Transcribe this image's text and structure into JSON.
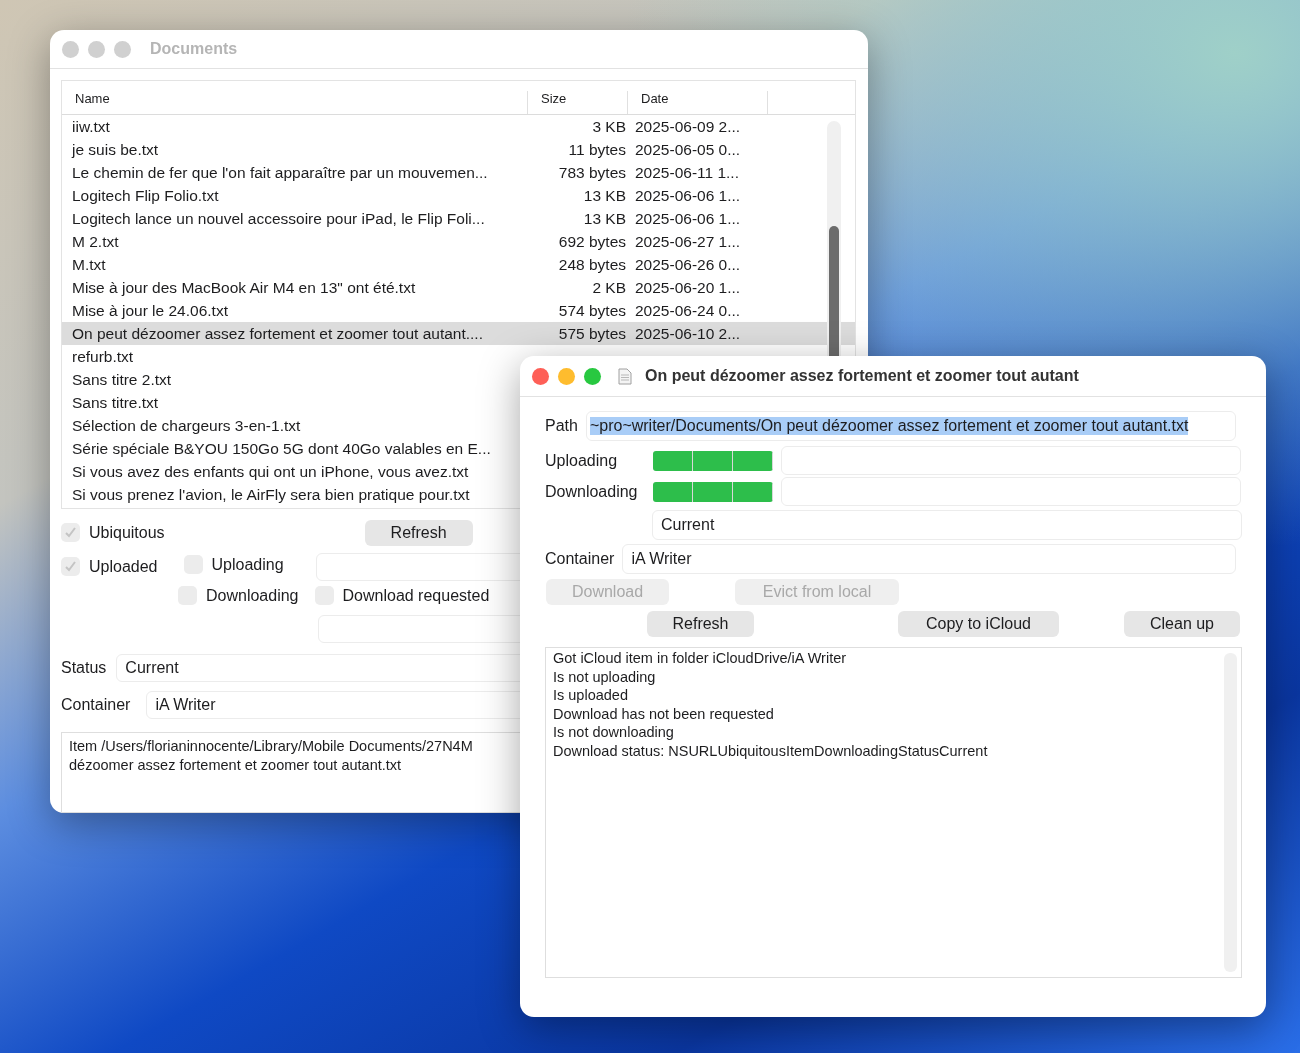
{
  "documents_window": {
    "title": "Documents",
    "active": false,
    "table": {
      "columns": [
        "Name",
        "Size",
        "Date"
      ],
      "rows": [
        {
          "name": "iiw.txt",
          "size": "3 KB",
          "date": "2025-06-09 2...",
          "selected": false
        },
        {
          "name": "je suis be.txt",
          "size": "11 bytes",
          "date": "2025-06-05 0...",
          "selected": false
        },
        {
          "name": "Le chemin de fer que l'on fait apparaître par un mouvemen...",
          "size": "783 bytes",
          "date": "2025-06-11 1...",
          "selected": false
        },
        {
          "name": "Logitech Flip Folio.txt",
          "size": "13 KB",
          "date": "2025-06-06 1...",
          "selected": false
        },
        {
          "name": "Logitech lance un nouvel accessoire pour iPad, le Flip Foli...",
          "size": "13 KB",
          "date": "2025-06-06 1...",
          "selected": false
        },
        {
          "name": "M 2.txt",
          "size": "692 bytes",
          "date": "2025-06-27 1...",
          "selected": false
        },
        {
          "name": "M.txt",
          "size": "248 bytes",
          "date": "2025-06-26 0...",
          "selected": false
        },
        {
          "name": "Mise à jour des MacBook Air M4 en 13\" ont été.txt",
          "size": "2 KB",
          "date": "2025-06-20 1...",
          "selected": false
        },
        {
          "name": "Mise à jour le 24.06.txt",
          "size": "574 bytes",
          "date": "2025-06-24 0...",
          "selected": false
        },
        {
          "name": "On peut dézoomer assez fortement et zoomer tout autant....",
          "size": "575 bytes",
          "date": "2025-06-10 2...",
          "selected": true
        },
        {
          "name": "refurb.txt",
          "selected": false
        },
        {
          "name": "Sans titre 2.txt",
          "selected": false
        },
        {
          "name": "Sans titre.txt",
          "selected": false
        },
        {
          "name": "Sélection de chargeurs 3-en-1.txt",
          "selected": false
        },
        {
          "name": "Série spéciale B&YOU 150Go 5G dont 40Go valables en E...",
          "selected": false
        },
        {
          "name": "Si vous avez des enfants qui ont un iPhone, vous avez.txt",
          "selected": false
        },
        {
          "name": "Si vous prenez l'avion, le AirFly sera bien pratique pour.txt",
          "selected": false
        }
      ]
    },
    "checkboxes": [
      {
        "label": "Ubiquitous",
        "checked": true
      },
      {
        "label": "Uploaded",
        "checked": true
      },
      {
        "label": "Uploading",
        "checked": false
      },
      {
        "label": "Downloading",
        "checked": false
      },
      {
        "label": "Download requested",
        "checked": false
      }
    ],
    "refresh_button": "Refresh",
    "status": {
      "label": "Status",
      "value": "Current"
    },
    "container": {
      "label": "Container",
      "value": "iA Writer"
    },
    "details_lines": [
      "Item /Users/florianinnocente/Library/Mobile Documents/27N4M",
      "dézoomer assez fortement et zoomer tout autant.txt"
    ]
  },
  "item_window": {
    "title": "On peut dézoomer assez fortement et zoomer tout autant",
    "active": true,
    "path": {
      "label": "Path",
      "value": "~pro~writer/Documents/On peut dézoomer assez fortement et zoomer tout autant.txt",
      "selected": true
    },
    "meters": [
      {
        "label": "Uploading",
        "level": 1
      },
      {
        "label": "Downloading",
        "level": 1
      }
    ],
    "status_value": "Current",
    "container": {
      "label": "Container",
      "value": "iA Writer"
    },
    "action_buttons": [
      {
        "label": "Download",
        "disabled": true
      },
      {
        "label": "Evict from local",
        "disabled": true
      }
    ],
    "buttons": [
      {
        "label": "Refresh",
        "disabled": false
      },
      {
        "label": "Copy to iCloud",
        "disabled": false
      },
      {
        "label": "Clean up",
        "disabled": false
      }
    ],
    "log_lines": [
      "Got iCloud item in folder iCloudDrive/iA Writer",
      "Is not uploading",
      "Is uploaded",
      "Download has not been requested",
      "Is not downloading",
      "Download status: NSURLUbiquitousItemDownloadingStatusCurrent"
    ]
  }
}
